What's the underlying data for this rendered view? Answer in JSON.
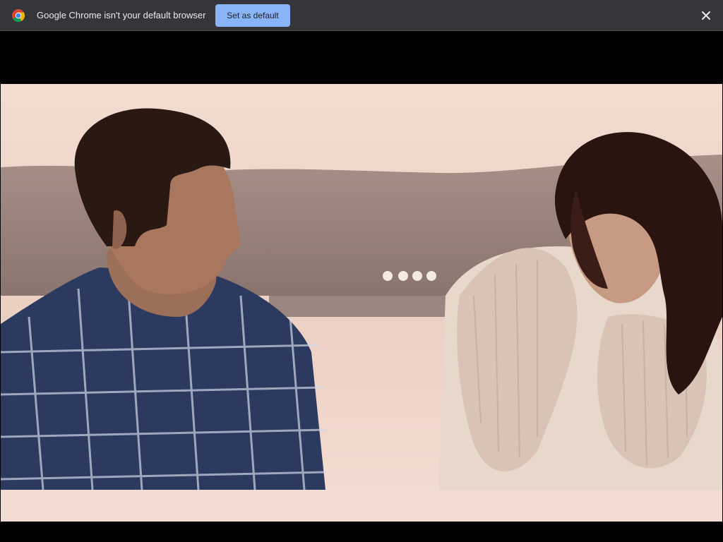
{
  "infobar": {
    "message": "Google Chrome isn't your default browser",
    "set_default_label": "Set as default",
    "logo_icon": "chrome-logo-icon",
    "close_icon": "close-icon",
    "button_color": "#8ab4f8",
    "background_color": "#35363a"
  },
  "video": {
    "scene_icons": [
      "man-in-plaid-shirt",
      "woman-in-fringe-cardigan",
      "waterfront-hills-background"
    ]
  }
}
